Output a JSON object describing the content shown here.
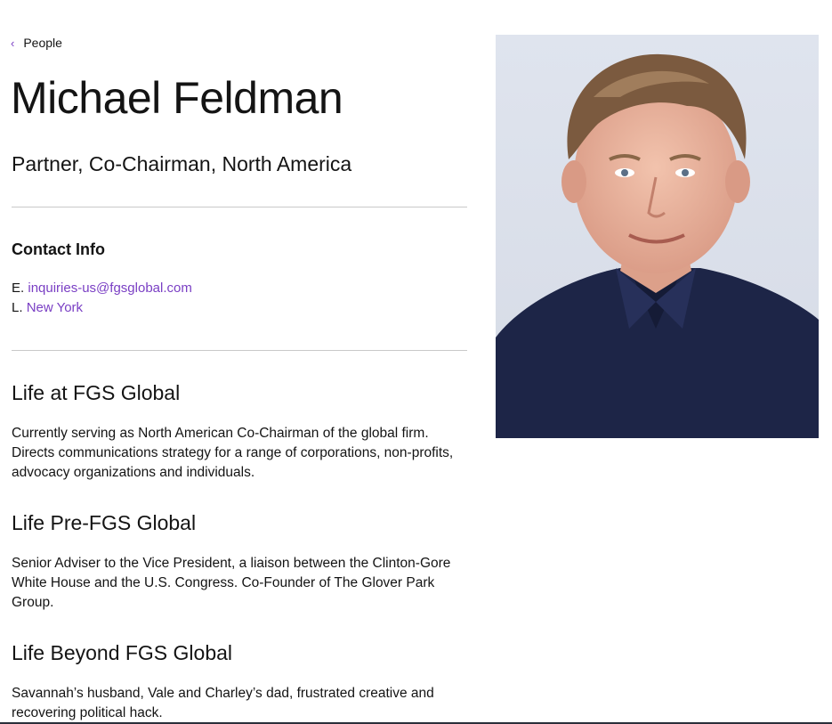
{
  "nav": {
    "back_label": "People"
  },
  "person": {
    "name": "Michael Feldman",
    "title": "Partner, Co-Chairman, North America"
  },
  "contact": {
    "heading": "Contact Info",
    "email_prefix": "E.",
    "email": "inquiries-us@fgsglobal.com",
    "location_prefix": "L.",
    "location": "New York"
  },
  "sections": [
    {
      "heading": "Life at FGS Global",
      "text": "Currently serving as North American Co-Chairman of the global firm. Directs communications strategy for a range of corporations, non-profits, advocacy organizations and individuals."
    },
    {
      "heading": "Life Pre-FGS Global",
      "text": "Senior Adviser to the Vice President, a liaison between the Clinton-Gore White House and the U.S. Congress. Co-Founder of The Glover Park Group."
    },
    {
      "heading": "Life Beyond FGS Global",
      "text": "Savannah’s husband, Vale and Charley’s dad, frustrated creative and recovering political hack."
    }
  ],
  "colors": {
    "accent": "#7a3fc4",
    "text": "#141414",
    "rule": "#c9c9c9",
    "shirt": "#1d2547"
  }
}
